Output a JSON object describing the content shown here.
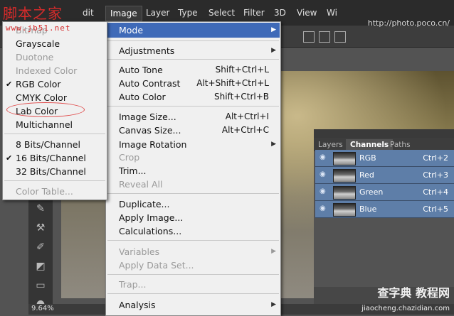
{
  "watermarks": {
    "top_left": "脚本之家",
    "url_left": "www.jb51.net",
    "top_right_url": "http://photo.poco.cn/",
    "bottom_right": "查字典 教程网",
    "bottom_right_url": "jiaocheng.chazidian.com"
  },
  "menubar": {
    "items": [
      "Image",
      "Layer",
      "Type",
      "Select",
      "Filter",
      "3D",
      "View"
    ],
    "partial_edit": "dit",
    "partial_right": "Wi"
  },
  "image_menu": {
    "mode": "Mode",
    "adjustments": "Adjustments",
    "auto_tone": {
      "label": "Auto Tone",
      "shortcut": "Shift+Ctrl+L"
    },
    "auto_contrast": {
      "label": "Auto Contrast",
      "shortcut": "Alt+Shift+Ctrl+L"
    },
    "auto_color": {
      "label": "Auto Color",
      "shortcut": "Shift+Ctrl+B"
    },
    "image_size": {
      "label": "Image Size...",
      "shortcut": "Alt+Ctrl+I"
    },
    "canvas_size": {
      "label": "Canvas Size...",
      "shortcut": "Alt+Ctrl+C"
    },
    "image_rotation": "Image Rotation",
    "crop": "Crop",
    "trim": "Trim...",
    "reveal_all": "Reveal All",
    "duplicate": "Duplicate...",
    "apply_image": "Apply Image...",
    "calculations": "Calculations...",
    "variables": "Variables",
    "apply_data_set": "Apply Data Set...",
    "trap": "Trap...",
    "analysis": "Analysis"
  },
  "mode_submenu": {
    "bitmap": "Bitmap",
    "grayscale": "Grayscale",
    "duotone": "Duotone",
    "indexed_color": "Indexed Color",
    "rgb_color": "RGB Color",
    "cmyk_color": "CMYK Color",
    "lab_color": "Lab Color",
    "multichannel": "Multichannel",
    "bits8": "8 Bits/Channel",
    "bits16": "16 Bits/Channel",
    "bits32": "32 Bits/Channel",
    "color_table": "Color Table...",
    "check": "✔"
  },
  "panel": {
    "tabs": [
      "Layers",
      "Channels",
      "Paths"
    ],
    "channels": [
      {
        "name": "RGB",
        "shortcut": "Ctrl+2"
      },
      {
        "name": "Red",
        "shortcut": "Ctrl+3"
      },
      {
        "name": "Green",
        "shortcut": "Ctrl+4"
      },
      {
        "name": "Blue",
        "shortcut": "Ctrl+5"
      }
    ]
  },
  "status": {
    "zoom": "9.64%"
  },
  "colors": {
    "menu_highlight": "#3f6ab8",
    "channel_row": "#5e7ea8",
    "annotation": "#e04a4a"
  }
}
